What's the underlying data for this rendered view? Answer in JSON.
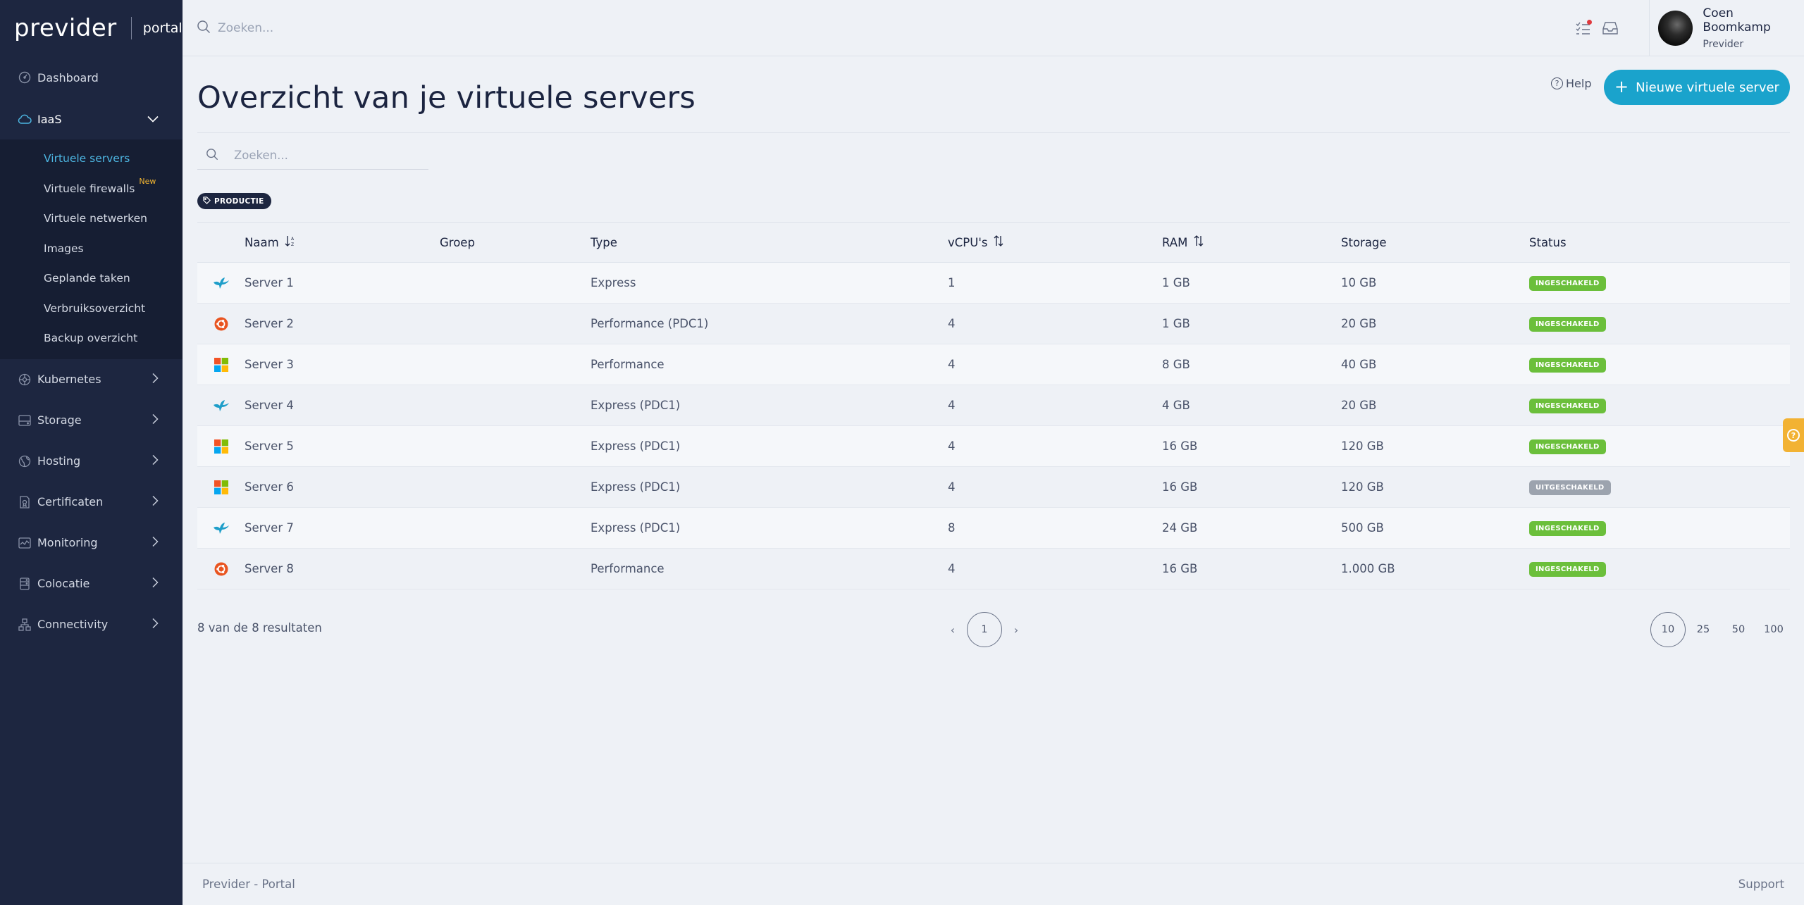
{
  "brand": {
    "logo": "previder",
    "portal": "portal"
  },
  "search": {
    "placeholder": "Zoeken..."
  },
  "user": {
    "name": "Coen Boomkamp",
    "org": "Previder"
  },
  "sidebar": {
    "dashboard": "Dashboard",
    "iaas": "IaaS",
    "iaas_items": [
      "Virtuele servers",
      "Virtuele firewalls",
      "Virtuele netwerken",
      "Images",
      "Geplande taken",
      "Verbruiksoverzicht",
      "Backup overzicht"
    ],
    "new_tag": "New",
    "sections": [
      "Kubernetes",
      "Storage",
      "Hosting",
      "Certificaten",
      "Monitoring",
      "Colocatie",
      "Connectivity"
    ]
  },
  "page": {
    "title": "Overzicht van je virtuele servers",
    "help": "Help",
    "new_button": "Nieuwe virtuele server",
    "filter_placeholder": "Zoeken...",
    "tag": "PRODUCTIE"
  },
  "table": {
    "headers": {
      "naam": "Naam",
      "groep": "Groep",
      "type": "Type",
      "vcpu": "vCPU's",
      "ram": "RAM",
      "storage": "Storage",
      "status": "Status"
    },
    "rows": [
      {
        "os": "bird-icon",
        "name": "Server 1",
        "group": "",
        "type": "Express",
        "vcpu": "1",
        "ram": "1 GB",
        "storage": "10 GB",
        "status": "INGESCHAKELD"
      },
      {
        "os": "ubuntu-icon",
        "name": "Server 2",
        "group": "",
        "type": "Performance (PDC1)",
        "vcpu": "4",
        "ram": "1 GB",
        "storage": "20 GB",
        "status": "INGESCHAKELD"
      },
      {
        "os": "windows-icon",
        "name": "Server 3",
        "group": "",
        "type": "Performance",
        "vcpu": "4",
        "ram": "8 GB",
        "storage": "40 GB",
        "status": "INGESCHAKELD"
      },
      {
        "os": "bird-icon",
        "name": "Server 4",
        "group": "",
        "type": "Express (PDC1)",
        "vcpu": "4",
        "ram": "4 GB",
        "storage": "20 GB",
        "status": "INGESCHAKELD"
      },
      {
        "os": "windows-icon",
        "name": "Server 5",
        "group": "",
        "type": "Express (PDC1)",
        "vcpu": "4",
        "ram": "16 GB",
        "storage": "120 GB",
        "status": "INGESCHAKELD"
      },
      {
        "os": "windows-icon",
        "name": "Server 6",
        "group": "",
        "type": "Express (PDC1)",
        "vcpu": "4",
        "ram": "16 GB",
        "storage": "120 GB",
        "status": "UITGESCHAKELD"
      },
      {
        "os": "bird-icon",
        "name": "Server 7",
        "group": "",
        "type": "Express (PDC1)",
        "vcpu": "8",
        "ram": "24 GB",
        "storage": "500 GB",
        "status": "INGESCHAKELD"
      },
      {
        "os": "ubuntu-icon",
        "name": "Server 8",
        "group": "",
        "type": "Performance",
        "vcpu": "4",
        "ram": "16 GB",
        "storage": "1.000 GB",
        "status": "INGESCHAKELD"
      }
    ]
  },
  "pagination": {
    "results": "8 van de 8 resultaten",
    "prev": "‹",
    "current_page": "1",
    "next": "›",
    "page_sizes": [
      "10",
      "25",
      "50",
      "100"
    ],
    "active_size": "10"
  },
  "footer": {
    "left": "Previder - Portal",
    "right": "Support"
  },
  "colors": {
    "accent": "#1aa3cc",
    "sidebar": "#1d2640",
    "status_on": "#6bbf3b",
    "status_off": "#9ca3ae",
    "new_tag": "#f5b731"
  }
}
